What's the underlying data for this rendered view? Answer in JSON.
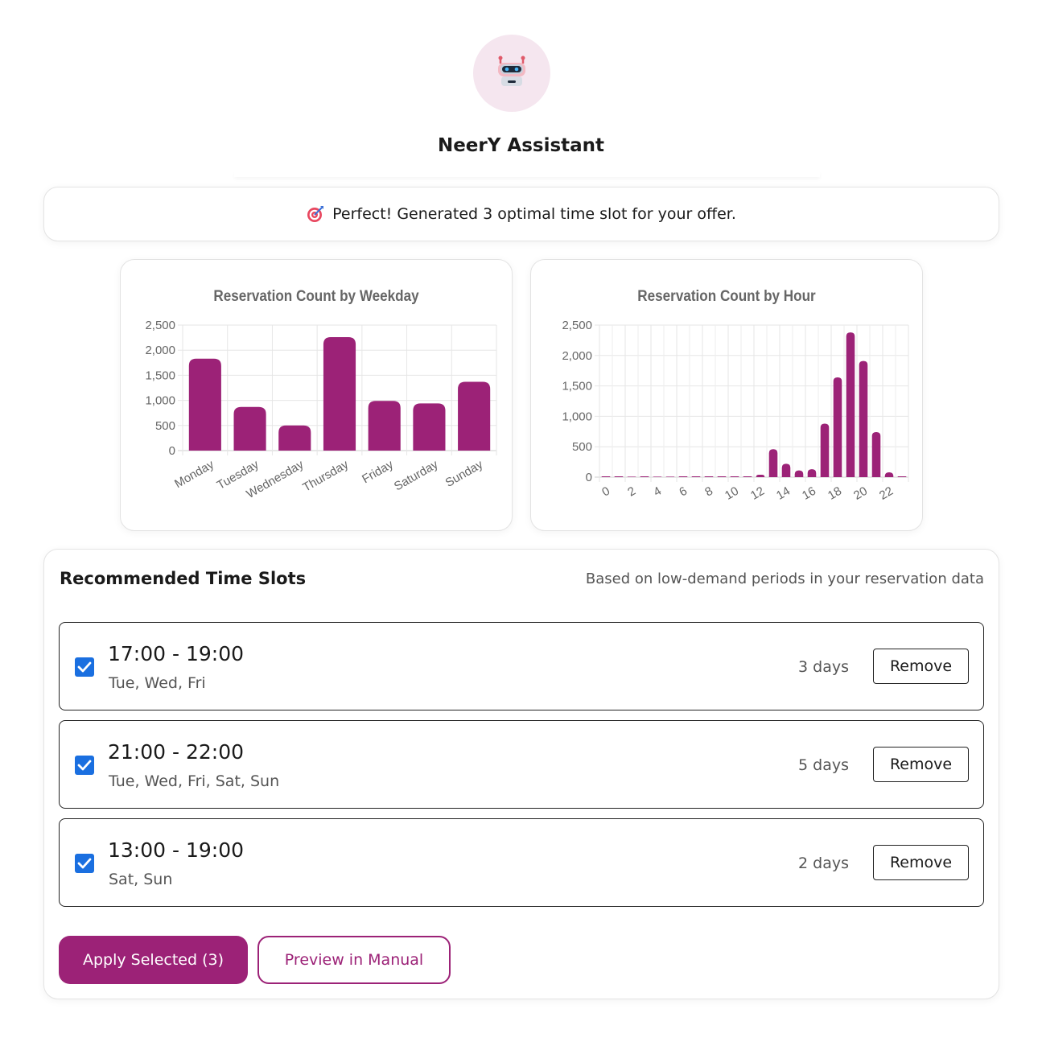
{
  "assistant": {
    "name": "NeerY Assistant",
    "avatar_icon": "robot-icon"
  },
  "banner": {
    "icon": "target-icon",
    "message": "Perfect! Generated 3 optimal time slot for your offer."
  },
  "colors": {
    "accent": "#9c2277",
    "checkbox": "#1a6fe0",
    "avatar_bg": "#f5e6ef"
  },
  "chart_data": [
    {
      "type": "bar",
      "title": "Reservation Count by Weekday",
      "categories": [
        "Monday",
        "Tuesday",
        "Wednesday",
        "Thursday",
        "Friday",
        "Saturday",
        "Sunday"
      ],
      "values": [
        1830,
        870,
        500,
        2260,
        990,
        940,
        1370
      ],
      "ylim": [
        0,
        2500
      ],
      "yticks": [
        "0",
        "500",
        "1,000",
        "1,500",
        "2,000",
        "2,500"
      ],
      "grid": true,
      "color": "#9c2277"
    },
    {
      "type": "bar",
      "title": "Reservation Count by Hour",
      "categories": [
        "0",
        "1",
        "2",
        "3",
        "4",
        "5",
        "6",
        "7",
        "8",
        "9",
        "10",
        "11",
        "12",
        "13",
        "14",
        "15",
        "16",
        "17",
        "18",
        "19",
        "20",
        "21",
        "22",
        "23"
      ],
      "values": [
        0,
        0,
        8,
        0,
        8,
        8,
        0,
        0,
        0,
        0,
        5,
        5,
        40,
        460,
        220,
        110,
        130,
        880,
        1640,
        2380,
        1910,
        740,
        80,
        5
      ],
      "xtick_labels": [
        "0",
        "2",
        "4",
        "6",
        "8",
        "10",
        "12",
        "14",
        "16",
        "18",
        "20",
        "22"
      ],
      "ylim": [
        0,
        2500
      ],
      "yticks": [
        "0",
        "500",
        "1,000",
        "1,500",
        "2,000",
        "2,500"
      ],
      "grid": true,
      "color": "#9c2277"
    }
  ],
  "recommendations": {
    "title": "Recommended Time Slots",
    "subtitle": "Based on low-demand periods in your reservation data",
    "slots": [
      {
        "time": "17:00 - 19:00",
        "days": "Tue, Wed, Fri",
        "count": "3 days",
        "checked": true,
        "remove_label": "Remove"
      },
      {
        "time": "21:00 - 22:00",
        "days": "Tue, Wed, Fri, Sat, Sun",
        "count": "5 days",
        "checked": true,
        "remove_label": "Remove"
      },
      {
        "time": "13:00 - 19:00",
        "days": "Sat, Sun",
        "count": "2 days",
        "checked": true,
        "remove_label": "Remove"
      }
    ],
    "apply_label": "Apply Selected (3)",
    "preview_label": "Preview in Manual"
  }
}
